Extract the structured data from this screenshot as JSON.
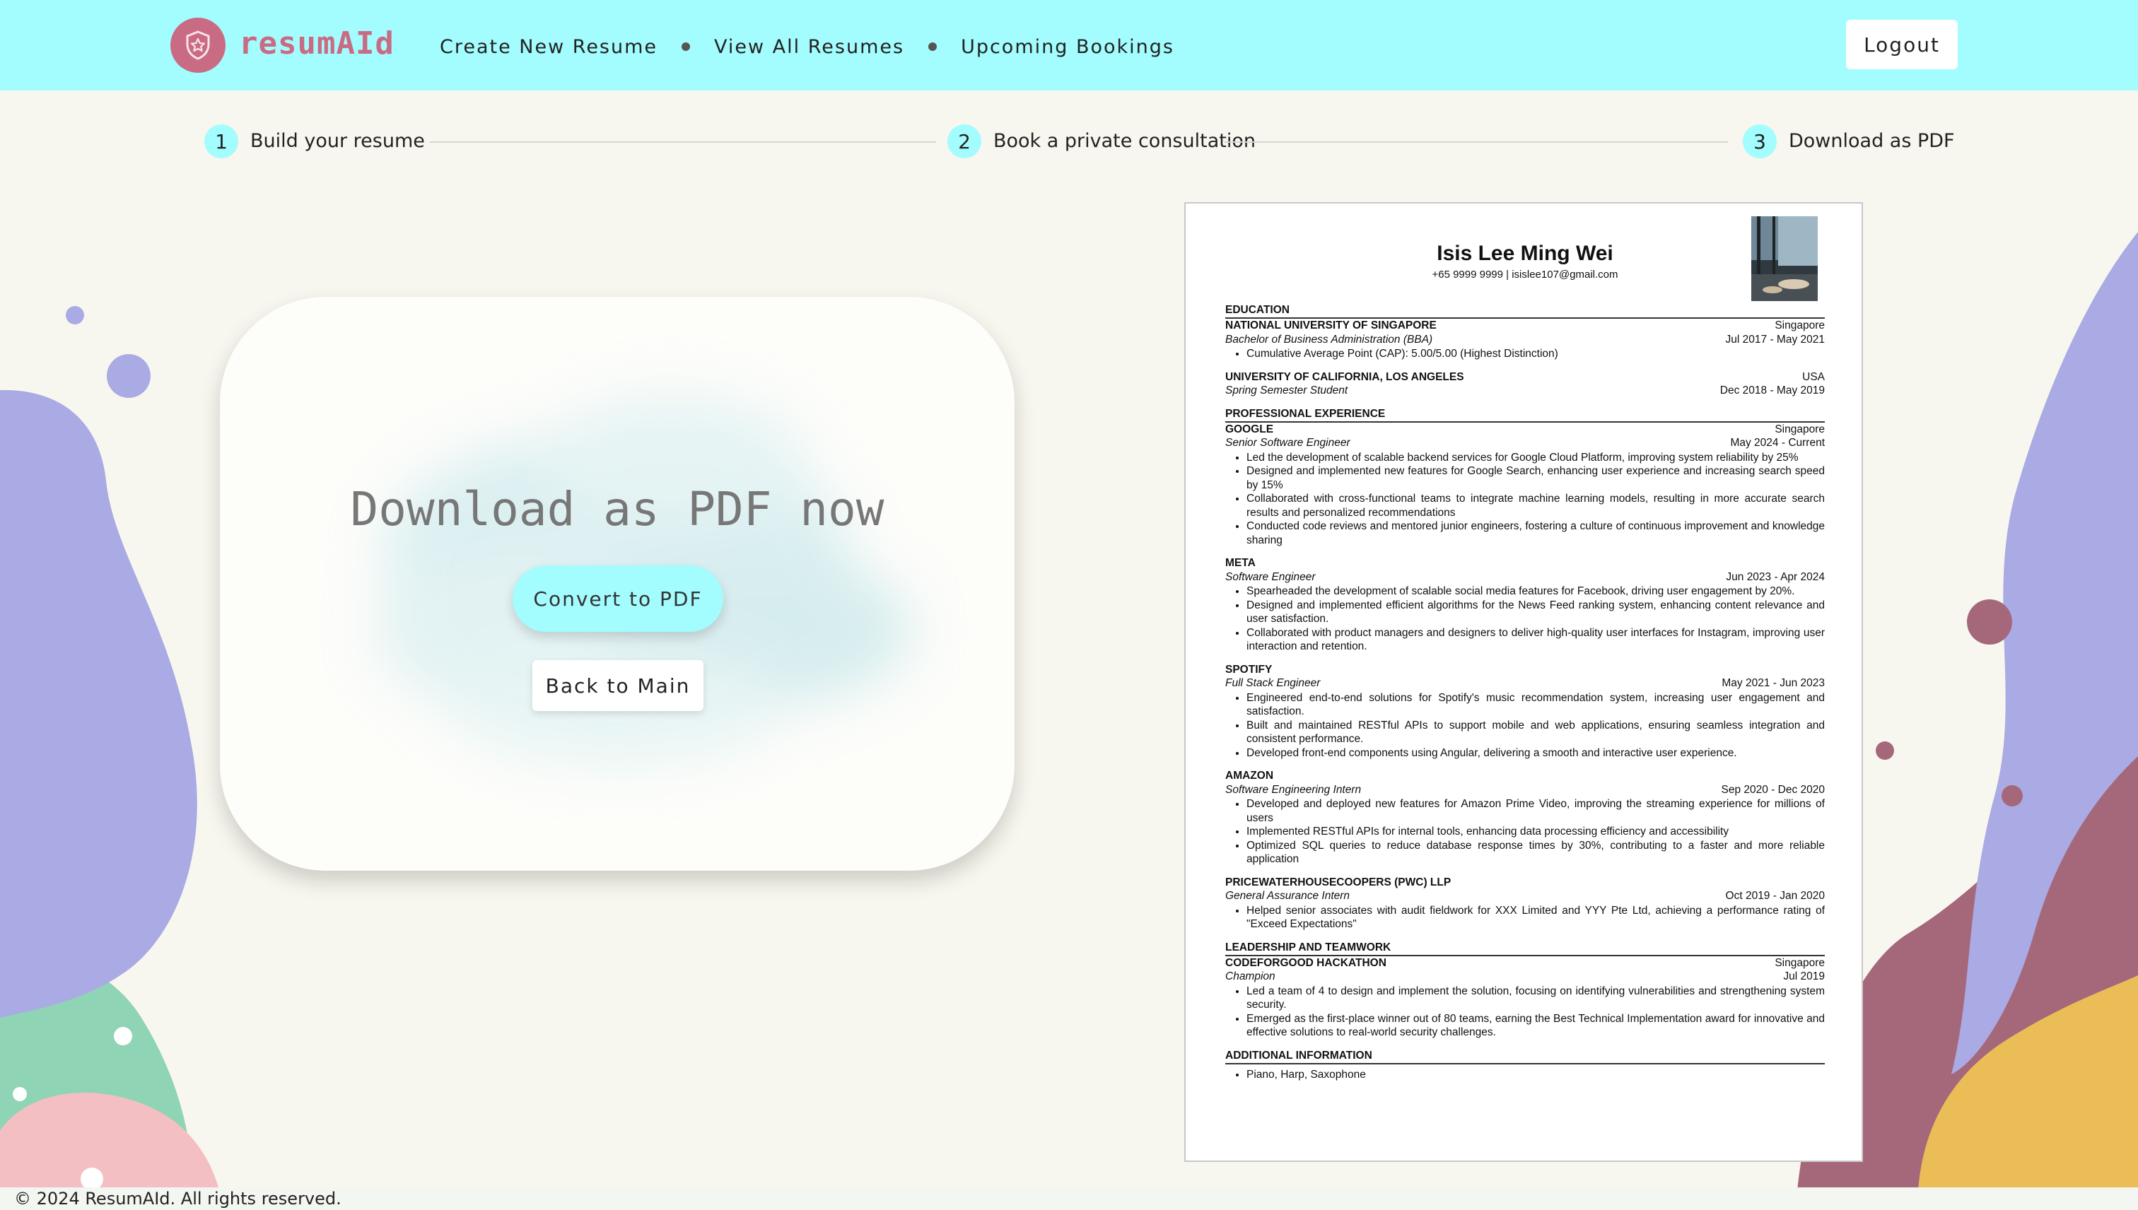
{
  "header": {
    "logo_text": "resumAId",
    "nav": [
      "Create New Resume",
      "View All Resumes",
      "Upcoming Bookings"
    ],
    "logout_label": "Logout"
  },
  "steps": [
    {
      "number": "1",
      "label": "Build your resume"
    },
    {
      "number": "2",
      "label": "Book a private consultation"
    },
    {
      "number": "3",
      "label": "Download as PDF"
    }
  ],
  "card": {
    "title": "Download as PDF now",
    "convert_label": "Convert to PDF",
    "back_label": "Back to Main"
  },
  "resume": {
    "name": "Isis Lee Ming Wei",
    "contact": "+65 9999 9999 | isislee107@gmail.com",
    "sections": {
      "education": "EDUCATION",
      "experience": "PROFESSIONAL EXPERIENCE",
      "leadership": "LEADERSHIP AND TEAMWORK",
      "additional": "ADDITIONAL INFORMATION"
    },
    "education": [
      {
        "org": "NATIONAL UNIVERSITY OF SINGAPORE",
        "location": "Singapore",
        "role": "Bachelor of Business Administration (BBA)",
        "dates": "Jul 2017 - May 2021",
        "bullets": [
          "Cumulative Average Point (CAP): 5.00/5.00 (Highest Distinction)"
        ]
      },
      {
        "org": "UNIVERSITY OF CALIFORNIA, LOS ANGELES",
        "location": "USA",
        "role": "Spring Semester Student",
        "dates": "Dec 2018 - May 2019",
        "bullets": []
      }
    ],
    "experience": [
      {
        "org": "GOOGLE",
        "location": "Singapore",
        "role": "Senior Software Engineer",
        "dates": "May 2024 - Current",
        "bullets": [
          "Led the development of scalable backend services for Google Cloud Platform, improving system reliability by 25%",
          "Designed and implemented new features for Google Search, enhancing user experience and increasing search speed by 15%",
          "Collaborated with cross-functional teams to integrate machine learning models, resulting in more accurate search results and personalized recommendations",
          "Conducted code reviews and mentored junior engineers, fostering a culture of continuous improvement and knowledge sharing"
        ]
      },
      {
        "org": "META",
        "location": "",
        "role": "Software Engineer",
        "dates": "Jun 2023 - Apr 2024",
        "bullets": [
          "Spearheaded the development of scalable social media features for Facebook, driving user engagement by 20%.",
          "Designed and implemented efficient algorithms for the News Feed ranking system, enhancing content relevance and user satisfaction.",
          "Collaborated with product managers and designers to deliver high-quality user interfaces for Instagram, improving user interaction and retention."
        ]
      },
      {
        "org": "SPOTIFY",
        "location": "",
        "role": "Full Stack Engineer",
        "dates": "May 2021 - Jun 2023",
        "bullets": [
          "Engineered end-to-end solutions for Spotify's music recommendation system, increasing user engagement and satisfaction.",
          "Built and maintained RESTful APIs to support mobile and web applications, ensuring seamless integration and consistent performance.",
          "Developed front-end components using Angular, delivering a smooth and interactive user experience."
        ]
      },
      {
        "org": "AMAZON",
        "location": "",
        "role": "Software Engineering Intern",
        "dates": "Sep 2020 - Dec 2020",
        "bullets": [
          "Developed and deployed new features for Amazon Prime Video, improving the streaming experience for millions of users",
          "Implemented RESTful APIs for internal tools, enhancing data processing efficiency and accessibility",
          "Optimized SQL queries to reduce database response times by 30%, contributing to a faster and more reliable application"
        ]
      },
      {
        "org": "PRICEWATERHOUSECOOPERS (PWC) LLP",
        "location": "",
        "role": "General Assurance Intern",
        "dates": "Oct 2019 - Jan 2020",
        "bullets": [
          "Helped senior associates with audit fieldwork for XXX Limited and YYY Pte Ltd, achieving a performance rating of \"Exceed Expectations\""
        ]
      }
    ],
    "leadership": [
      {
        "org": "CODEFORGOOD HACKATHON",
        "location": "Singapore",
        "role": "Champion",
        "dates": "Jul 2019",
        "bullets": [
          "Led a team of 4 to design and implement the solution, focusing on identifying vulnerabilities and strengthening system security.",
          "Emerged as the first-place winner out of 80 teams, earning the Best Technical Implementation award for innovative and effective solutions to real-world security challenges."
        ]
      }
    ],
    "additional": [
      "Piano, Harp, Saxophone"
    ]
  },
  "footer": {
    "text": "© 2024 ResumAId. All rights reserved."
  },
  "colors": {
    "accent": "#a3fcfd",
    "brand": "#c96b83",
    "lavender": "#aaaae4",
    "mauve": "#a5687b",
    "mustard": "#ebbd57",
    "mint": "#8fd4b4",
    "pink": "#f4bfc3",
    "background": "#f8f7ef"
  }
}
